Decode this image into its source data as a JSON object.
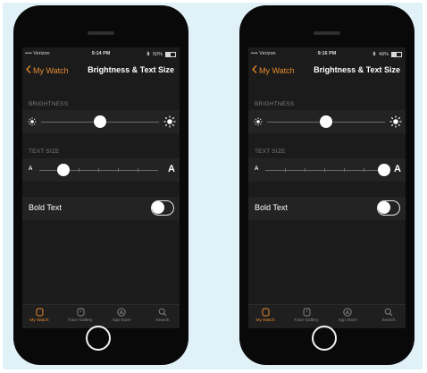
{
  "phones": [
    {
      "status": {
        "carrier": "•••• Verizon",
        "time": "9:14 PM",
        "battery": "50%",
        "battery_level": 0.5
      },
      "nav": {
        "back_label": "My Watch",
        "title": "Brightness & Text Size"
      },
      "brightness": {
        "header": "BRIGHTNESS",
        "level": 0.5
      },
      "text_size": {
        "header": "TEXT SIZE",
        "small_label": "A",
        "large_label": "A",
        "level": 0.2
      },
      "bold_text": {
        "label": "Bold Text",
        "enabled": false
      },
      "tabs": [
        {
          "label": "My Watch",
          "icon": "watch-icon",
          "active": true
        },
        {
          "label": "Face Gallery",
          "icon": "face-gallery-icon",
          "active": false
        },
        {
          "label": "App Store",
          "icon": "app-store-icon",
          "active": false
        },
        {
          "label": "Search",
          "icon": "search-icon",
          "active": false
        }
      ]
    },
    {
      "status": {
        "carrier": "•••• Verizon",
        "time": "9:16 PM",
        "battery": "49%",
        "battery_level": 0.49
      },
      "nav": {
        "back_label": "My Watch",
        "title": "Brightness & Text Size"
      },
      "brightness": {
        "header": "BRIGHTNESS",
        "level": 0.5
      },
      "text_size": {
        "header": "TEXT SIZE",
        "small_label": "A",
        "large_label": "A",
        "level": 1.0
      },
      "bold_text": {
        "label": "Bold Text",
        "enabled": false
      },
      "tabs": [
        {
          "label": "My Watch",
          "icon": "watch-icon",
          "active": true
        },
        {
          "label": "Face Gallery",
          "icon": "face-gallery-icon",
          "active": false
        },
        {
          "label": "App Store",
          "icon": "app-store-icon",
          "active": false
        },
        {
          "label": "Search",
          "icon": "search-icon",
          "active": false
        }
      ]
    }
  ],
  "colors": {
    "accent": "#e58a2d",
    "screen_bg": "#1b1b1b",
    "row_bg": "#232323",
    "panel_bg": "#e0f1f8"
  }
}
